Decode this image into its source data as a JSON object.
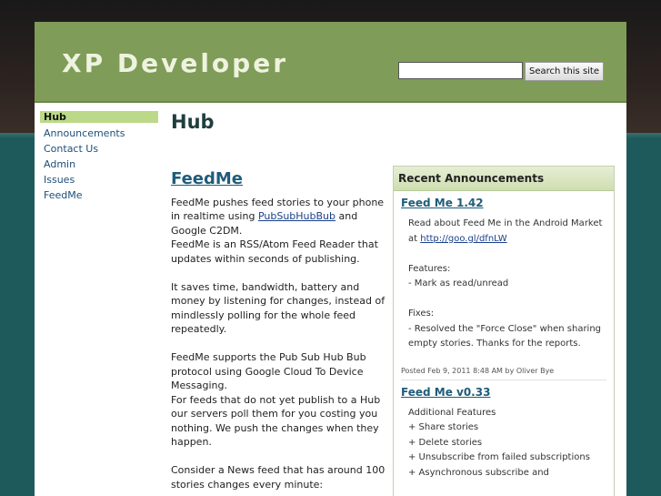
{
  "site": {
    "title": "XP Developer"
  },
  "search": {
    "placeholder": "",
    "button_label": "Search this site"
  },
  "sidebar": {
    "items": [
      {
        "label": "Hub"
      },
      {
        "label": "Announcements"
      },
      {
        "label": "Contact Us"
      },
      {
        "label": "Admin"
      },
      {
        "label": "Issues"
      },
      {
        "label": "FeedMe"
      }
    ]
  },
  "page": {
    "title": "Hub"
  },
  "main": {
    "heading": "FeedMe",
    "p1_before": "FeedMe pushes feed stories to your phone in realtime using ",
    "p1_link": "PubSubHubBub",
    "p1_after": " and Google C2DM.",
    "p1_line2": "FeedMe is an RSS/Atom Feed Reader that updates within seconds of publishing.",
    "p2": "It saves time, bandwidth, battery and money by listening for changes, instead of mindlessly polling for the whole feed repeatedly.",
    "p3a": "FeedMe supports the Pub Sub Hub Bub protocol using Google Cloud To Device Messaging.",
    "p3b": "For feeds that do not yet publish to a Hub our servers poll them for you costing you nothing. We push the changes when they happen.",
    "p4": "Consider a News feed that has around 100 stories changes every minute:"
  },
  "announcements": {
    "header": "Recent Announcements",
    "items": [
      {
        "title": "Feed Me 1.42",
        "line1": "Read about Feed Me in the Android Market at ",
        "link": "http://goo.gl/dfnLW",
        "features_label": "Features:",
        "feature1": "- Mark as read/unread",
        "fixes_label": "Fixes:",
        "fix1": "- Resolved the \"Force Close\" when sharing empty stories. Thanks for the reports.",
        "footer": "Posted Feb 9, 2011 8:48 AM by Oliver Bye"
      },
      {
        "title": "Feed Me v0.33",
        "label": "Additional Features",
        "item1": "+ Share stories",
        "item2": "+ Delete stories",
        "item3": "+ Unsubscribe from failed subscriptions",
        "item4": "+ Asynchronous subscribe and"
      }
    ]
  }
}
